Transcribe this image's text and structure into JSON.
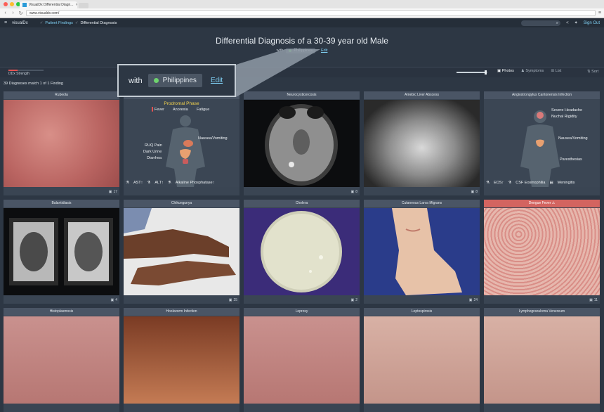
{
  "browser": {
    "tab_title": "VisualDx Differential Diagn...",
    "url": "www.visualdx.com/"
  },
  "header": {
    "logo": "visualDx",
    "breadcrumb": [
      {
        "label": "Patient Findings"
      },
      {
        "label": "Differential Diagnosis"
      }
    ],
    "sign_out": "Sign Out"
  },
  "page": {
    "title": "Differential Diagnosis of a 30-39 year old Male",
    "with_label": "with",
    "location_chip": "Philippines",
    "edit": "Edit",
    "strength_label": "DDx Strength",
    "strength_level": 0.25,
    "zoom_level": 0.9,
    "view_tabs": [
      "Photos",
      "Symptoms",
      "List"
    ],
    "active_view": "Photos",
    "sort": "Sort",
    "match_text": "39 Diagnoses match 1 of 1 Finding"
  },
  "callout": {
    "with_label": "with",
    "chip": "Philippines",
    "edit": "Edit"
  },
  "cards": [
    {
      "title": "Rubeola",
      "count": "17",
      "alert": false
    },
    {
      "title": "",
      "count": "",
      "alert": false
    },
    {
      "title": "Neurocysticercosis",
      "count": "8",
      "alert": false
    },
    {
      "title": "Amebic Liver Abscess",
      "count": "8",
      "alert": false
    },
    {
      "title": "Angiostrongylus Cantonensis Infection",
      "count": "",
      "alert": false
    },
    {
      "title": "Balantidiasis",
      "count": "4",
      "alert": false
    },
    {
      "title": "Chikungunya",
      "count": "25",
      "alert": false
    },
    {
      "title": "Cholera",
      "count": "2",
      "alert": false
    },
    {
      "title": "Cutaneous Larva Migrans",
      "count": "24",
      "alert": false
    },
    {
      "title": "Dengue Fever ⚠",
      "count": "11",
      "alert": true
    },
    {
      "title": "Histoplasmosis",
      "count": "",
      "alert": false
    },
    {
      "title": "Hookworm Infection",
      "count": "",
      "alert": false
    },
    {
      "title": "Leprosy",
      "count": "",
      "alert": false
    },
    {
      "title": "Leptospirosis",
      "count": "",
      "alert": false
    },
    {
      "title": "Lymphogranuloma Venereum",
      "count": "",
      "alert": false
    }
  ],
  "hepatitis_info": {
    "phase": "Prodromal Phase",
    "fever": "Fever",
    "anorexia": "Anorexia",
    "fatigue": "Fatigue",
    "nausea": "Nausea/Vomiting",
    "ruq": "RUQ Pain",
    "dark_urine": "Dark Urine",
    "diarrhea": "Diarrhea",
    "ast": "AST↑",
    "alt": "ALT↑",
    "alk": "Alkaline Phosphatase↑"
  },
  "angio_info": {
    "headache": "Severe Headache",
    "nuchal": "Nuchal Rigidity",
    "nausea": "Nausea/Vomiting",
    "paresthesias": "Paresthesias",
    "eos": "EOS↑",
    "csf": "CSF Eosinophilia",
    "meningitis": "Meningitis"
  },
  "colors": {
    "accent": "#7fd0f4",
    "alert": "#d36460",
    "phase": "#f2d24e",
    "background": "#2d3744"
  }
}
